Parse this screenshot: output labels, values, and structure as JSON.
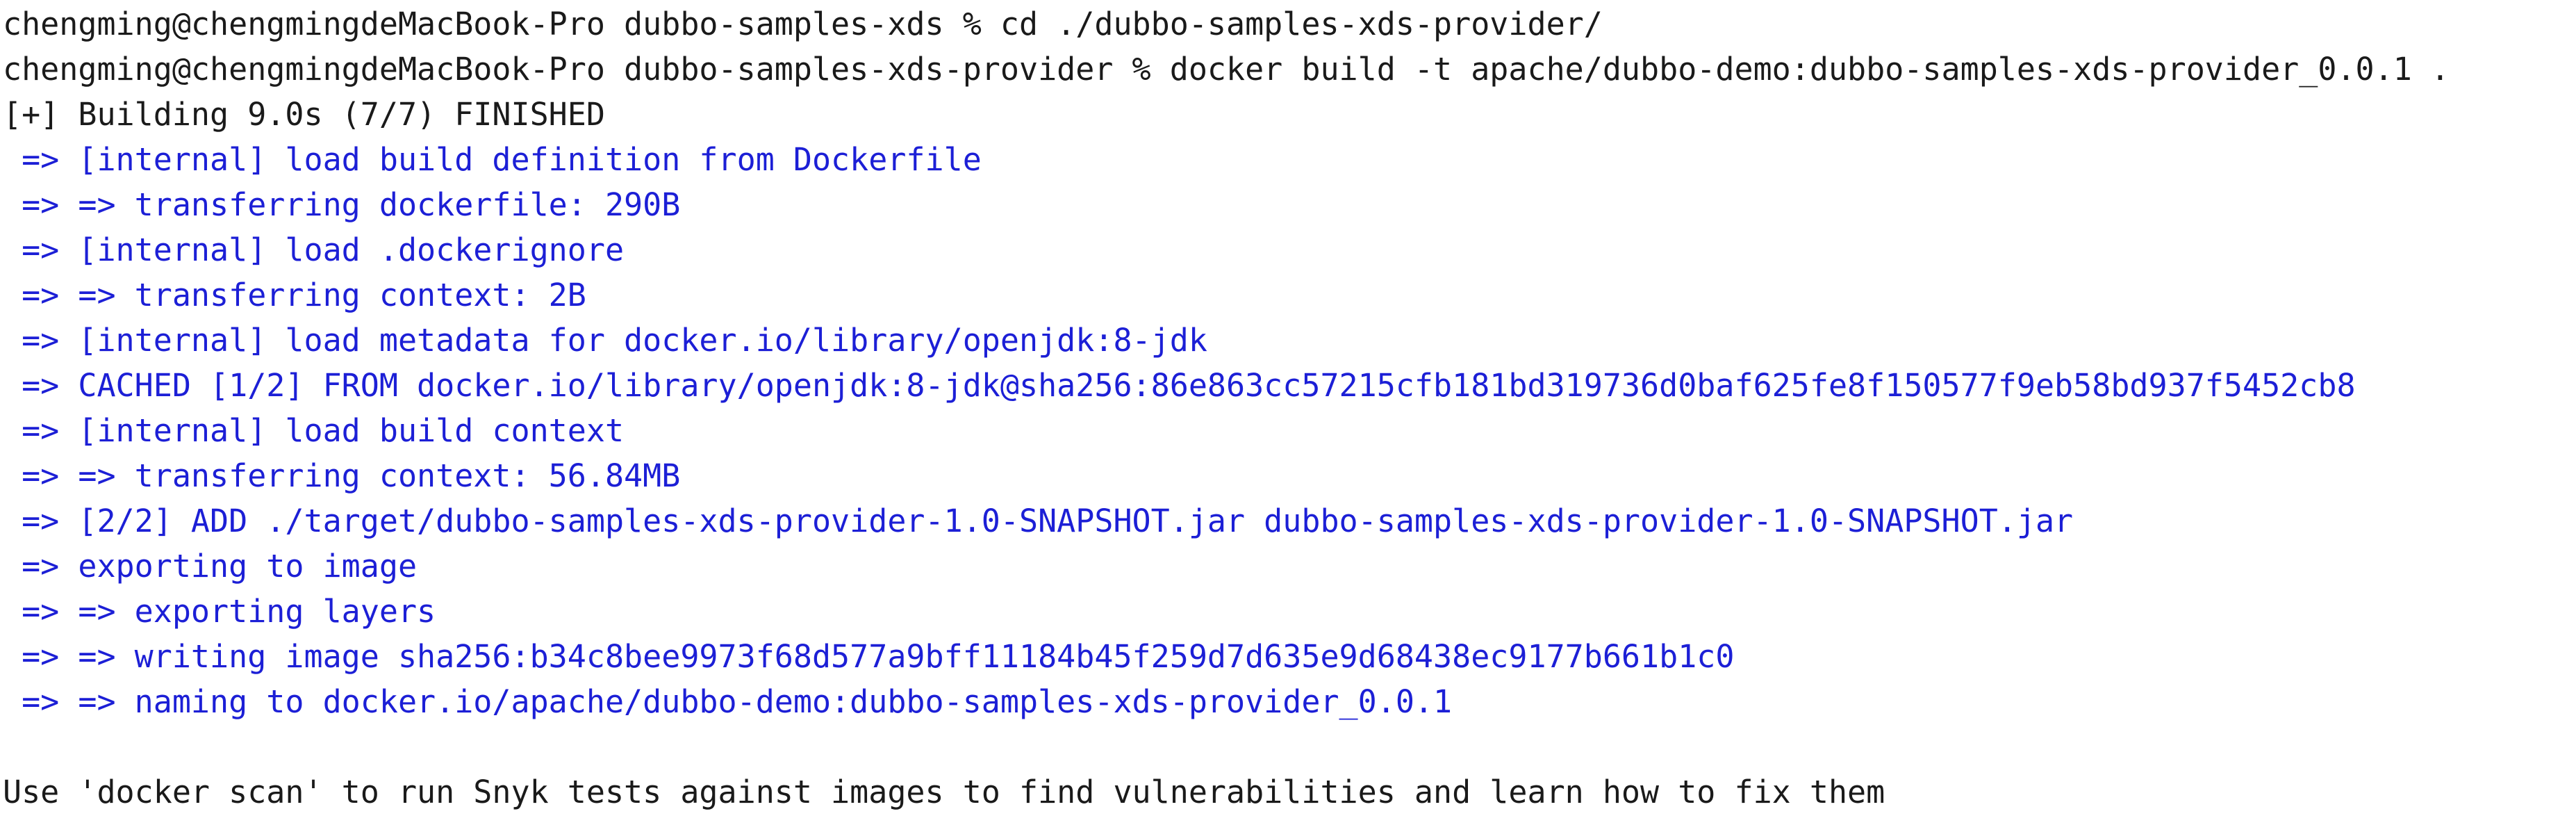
{
  "terminal": {
    "lines": [
      {
        "type": "cmd",
        "text": "chengming@chengmingdeMacBook-Pro dubbo-samples-xds % cd ./dubbo-samples-xds-provider/"
      },
      {
        "type": "cmd",
        "text": "chengming@chengmingdeMacBook-Pro dubbo-samples-xds-provider % docker build -t apache/dubbo-demo:dubbo-samples-xds-provider_0.0.1 ."
      },
      {
        "type": "plain",
        "text": "[+] Building 9.0s (7/7) FINISHED"
      },
      {
        "type": "build",
        "text": " => [internal] load build definition from Dockerfile"
      },
      {
        "type": "build",
        "text": " => => transferring dockerfile: 290B"
      },
      {
        "type": "build",
        "text": " => [internal] load .dockerignore"
      },
      {
        "type": "build",
        "text": " => => transferring context: 2B"
      },
      {
        "type": "build",
        "text": " => [internal] load metadata for docker.io/library/openjdk:8-jdk"
      },
      {
        "type": "build",
        "text": " => CACHED [1/2] FROM docker.io/library/openjdk:8-jdk@sha256:86e863cc57215cfb181bd319736d0baf625fe8f150577f9eb58bd937f5452cb8"
      },
      {
        "type": "build",
        "text": " => [internal] load build context"
      },
      {
        "type": "build",
        "text": " => => transferring context: 56.84MB"
      },
      {
        "type": "build",
        "text": " => [2/2] ADD ./target/dubbo-samples-xds-provider-1.0-SNAPSHOT.jar dubbo-samples-xds-provider-1.0-SNAPSHOT.jar"
      },
      {
        "type": "build",
        "text": " => exporting to image"
      },
      {
        "type": "build",
        "text": " => => exporting layers"
      },
      {
        "type": "build",
        "text": " => => writing image sha256:b34c8bee9973f68d577a9bff11184b45f259d7d635e9d68438ec9177b661b1c0"
      },
      {
        "type": "build",
        "text": " => => naming to docker.io/apache/dubbo-demo:dubbo-samples-xds-provider_0.0.1"
      },
      {
        "type": "blank",
        "text": ""
      },
      {
        "type": "plain",
        "text": "Use 'docker scan' to run Snyk tests against images to find vulnerabilities and learn how to fix them"
      }
    ]
  },
  "colors": {
    "background": "#ffffff",
    "text": "#1a1a1a",
    "build_output": "#1c1fd6"
  }
}
